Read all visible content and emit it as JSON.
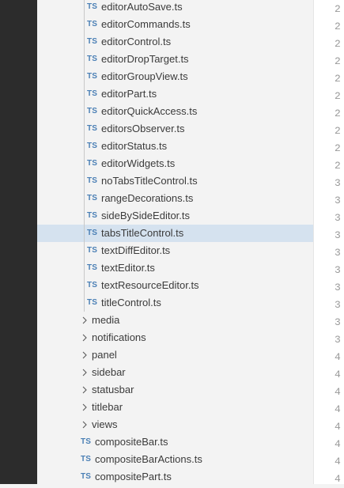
{
  "explorer": {
    "rows": [
      {
        "kind": "file",
        "level": 2,
        "icon": "TS",
        "label": "editorAutoSave.ts",
        "selected": false
      },
      {
        "kind": "file",
        "level": 2,
        "icon": "TS",
        "label": "editorCommands.ts",
        "selected": false
      },
      {
        "kind": "file",
        "level": 2,
        "icon": "TS",
        "label": "editorControl.ts",
        "selected": false
      },
      {
        "kind": "file",
        "level": 2,
        "icon": "TS",
        "label": "editorDropTarget.ts",
        "selected": false
      },
      {
        "kind": "file",
        "level": 2,
        "icon": "TS",
        "label": "editorGroupView.ts",
        "selected": false
      },
      {
        "kind": "file",
        "level": 2,
        "icon": "TS",
        "label": "editorPart.ts",
        "selected": false
      },
      {
        "kind": "file",
        "level": 2,
        "icon": "TS",
        "label": "editorQuickAccess.ts",
        "selected": false
      },
      {
        "kind": "file",
        "level": 2,
        "icon": "TS",
        "label": "editorsObserver.ts",
        "selected": false
      },
      {
        "kind": "file",
        "level": 2,
        "icon": "TS",
        "label": "editorStatus.ts",
        "selected": false
      },
      {
        "kind": "file",
        "level": 2,
        "icon": "TS",
        "label": "editorWidgets.ts",
        "selected": false
      },
      {
        "kind": "file",
        "level": 2,
        "icon": "TS",
        "label": "noTabsTitleControl.ts",
        "selected": false
      },
      {
        "kind": "file",
        "level": 2,
        "icon": "TS",
        "label": "rangeDecorations.ts",
        "selected": false
      },
      {
        "kind": "file",
        "level": 2,
        "icon": "TS",
        "label": "sideBySideEditor.ts",
        "selected": false
      },
      {
        "kind": "file",
        "level": 2,
        "icon": "TS",
        "label": "tabsTitleControl.ts",
        "selected": true
      },
      {
        "kind": "file",
        "level": 2,
        "icon": "TS",
        "label": "textDiffEditor.ts",
        "selected": false
      },
      {
        "kind": "file",
        "level": 2,
        "icon": "TS",
        "label": "textEditor.ts",
        "selected": false
      },
      {
        "kind": "file",
        "level": 2,
        "icon": "TS",
        "label": "textResourceEditor.ts",
        "selected": false
      },
      {
        "kind": "file",
        "level": 2,
        "icon": "TS",
        "label": "titleControl.ts",
        "selected": false
      },
      {
        "kind": "folder",
        "level": 1,
        "icon": "chevron-right-icon",
        "label": "media",
        "selected": false
      },
      {
        "kind": "folder",
        "level": 1,
        "icon": "chevron-right-icon",
        "label": "notifications",
        "selected": false
      },
      {
        "kind": "folder",
        "level": 1,
        "icon": "chevron-right-icon",
        "label": "panel",
        "selected": false
      },
      {
        "kind": "folder",
        "level": 1,
        "icon": "chevron-right-icon",
        "label": "sidebar",
        "selected": false
      },
      {
        "kind": "folder",
        "level": 1,
        "icon": "chevron-right-icon",
        "label": "statusbar",
        "selected": false
      },
      {
        "kind": "folder",
        "level": 1,
        "icon": "chevron-right-icon",
        "label": "titlebar",
        "selected": false
      },
      {
        "kind": "folder",
        "level": 1,
        "icon": "chevron-right-icon",
        "label": "views",
        "selected": false
      },
      {
        "kind": "file",
        "level": 1,
        "icon": "TS",
        "label": "compositeBar.ts",
        "selected": false
      },
      {
        "kind": "file",
        "level": 1,
        "icon": "TS",
        "label": "compositeBarActions.ts",
        "selected": false
      },
      {
        "kind": "file",
        "level": 1,
        "icon": "TS",
        "label": "compositePart.ts",
        "selected": false
      }
    ]
  },
  "editor": {
    "line_numbers": [
      "2",
      "2",
      "2",
      "2",
      "2",
      "2",
      "2",
      "2",
      "2",
      "2",
      "3",
      "3",
      "3",
      "3",
      "3",
      "3",
      "3",
      "3",
      "3",
      "3",
      "4",
      "4",
      "4",
      "4",
      "4",
      "4",
      "4",
      "4"
    ]
  },
  "colors": {
    "activity_bar": "#2c2c2c",
    "sidebar_background": "#f3f3f3",
    "selected_row": "#d5e2ef",
    "ts_icon": "#4a7fb5",
    "editor_background": "#ffffff"
  }
}
